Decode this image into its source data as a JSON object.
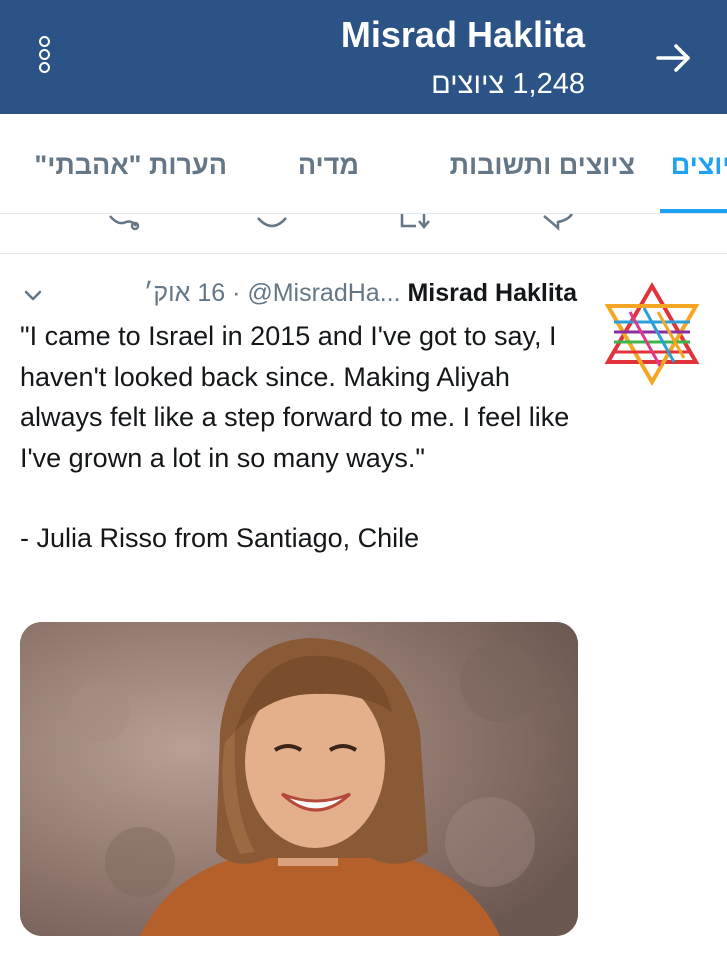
{
  "header": {
    "title": "Misrad Haklita",
    "tweet_count": "1,248 ציוצים",
    "menu_icon": "more-options-icon",
    "back_icon": "arrow-right-icon",
    "background": "#2b5385"
  },
  "tabs": [
    {
      "label": "הערות \"אהבתי\"",
      "active": false
    },
    {
      "label": "מדיה",
      "active": false
    },
    {
      "label": "ציוצים ותשובות",
      "active": false
    },
    {
      "label": "ציוצים",
      "active": true
    }
  ],
  "tweet": {
    "author_name": "Misrad Haklita",
    "handle": "@MisradHa...",
    "date": "16 אוק׳",
    "separator": " · ",
    "paragraphs": [
      "\"I came to Israel in 2015 and I've got to say, I haven't looked back since. Making Aliyah always felt like a step forward to me. I feel like I've grown a lot in so many ways.\"",
      "- Julia Risso from Santiago, Chile"
    ],
    "menu_icon": "chevron-down-icon",
    "media": "photo"
  },
  "colors": {
    "accent": "#1da1f2",
    "secondary_text": "#657786",
    "primary_text": "#14171a",
    "divider": "#e1e8ed"
  }
}
